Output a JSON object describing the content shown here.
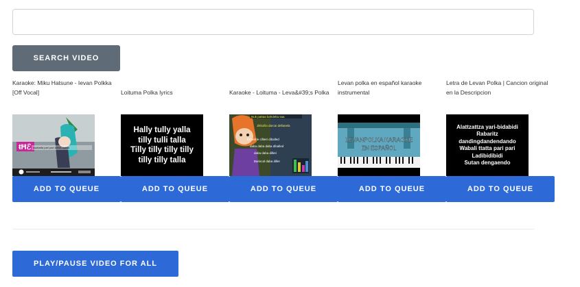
{
  "search": {
    "value": "",
    "placeholder": "",
    "button_label": "SEARCH VIDEO"
  },
  "results": [
    {
      "title_line1": "Karaoke: Miku Hatsune - Ievan Polkka",
      "title_line2": "[Off Vocal]",
      "queue_label": "ADD TO QUEUE"
    },
    {
      "title_line1": "",
      "title_line2": "Loituma Polka lyrics",
      "queue_label": "ADD TO QUEUE",
      "thumb_lines": [
        "Hally tully yalla",
        "tilly tulli talla",
        "Tilly tilly tilly tilly",
        "tilly tilly talla"
      ]
    },
    {
      "title_line1": "",
      "title_line2": "Karaoke - Loituma - Leva&#39;s Polka",
      "queue_label": "ADD TO QUEUE"
    },
    {
      "title_line1": "Levan polka en español karaoke",
      "title_line2": "instrumental",
      "queue_label": "ADD TO QUEUE",
      "thumb_caption": "LEVANPOLKA KARAOKE",
      "thumb_caption2": "EN ESPAÑOL"
    },
    {
      "title_line1": "Letra de Levan Polka | Cancion original",
      "title_line2": "en la Descripcion",
      "queue_label": "ADD TO QUEUE",
      "thumb_lines": [
        "Alattzattza yari-bidabidi",
        "Rabaritz",
        "dandingdandendando",
        "Wabali ttatta pari pari",
        "Ladibidibidi",
        "Sutan dengaendo"
      ]
    }
  ],
  "controls": {
    "play_pause_label": "PLAY/PAUSE VIDEO FOR ALL"
  },
  "colors": {
    "primary_button": "#2d6ad8",
    "secondary_button": "#5f6b77"
  }
}
